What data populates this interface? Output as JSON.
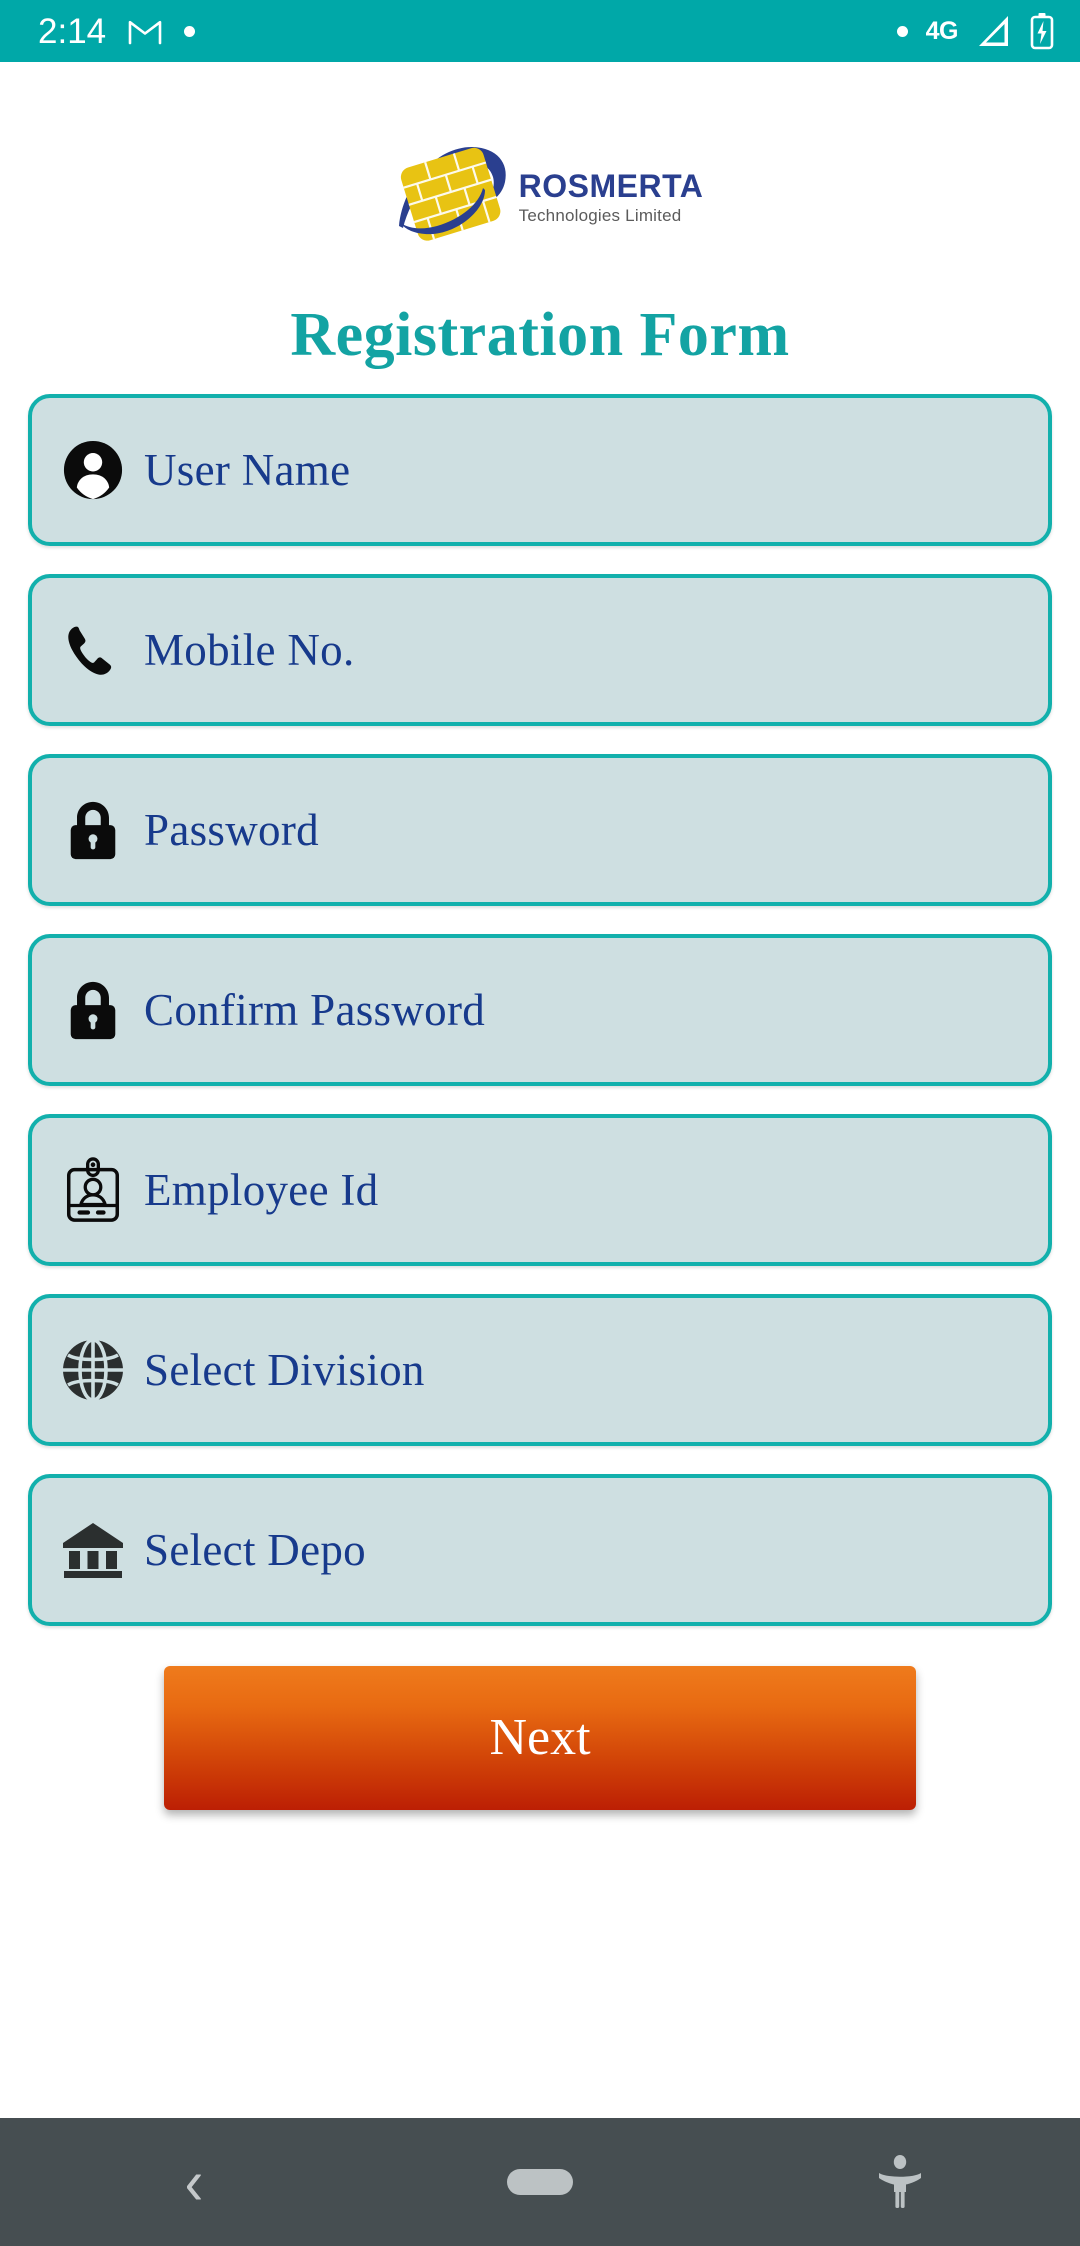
{
  "statusbar": {
    "time": "2:14",
    "left_icons": [
      {
        "name": "gmail-icon",
        "label": "M"
      },
      {
        "name": "notification-dot-icon",
        "label": ""
      }
    ],
    "right": {
      "dot": "",
      "network": "4G",
      "signal_icon": "signal-triangle-icon",
      "battery_icon": "battery-charging-icon"
    },
    "background_color": "#00a8a8",
    "foreground_color": "#ffffff"
  },
  "logo": {
    "name": "ROSMERTA",
    "subtitle": "Technologies Limited",
    "mark_icon": "rosmerta-brick-swoosh-logo",
    "name_color": "#2a3f8f",
    "subtitle_color": "#5b5b5b",
    "brick_color": "#e8c313",
    "swoosh_color": "#2a3f8f"
  },
  "form": {
    "title": "Registration Form",
    "title_color": "#13a3a3",
    "field_bg_color": "#cedfe1",
    "field_border_color": "#12b0ac",
    "field_text_color": "#173a8c",
    "fields": [
      {
        "icon": "person-icon",
        "placeholder": "User Name",
        "value": "",
        "type": "text"
      },
      {
        "icon": "phone-icon",
        "placeholder": "Mobile No.",
        "value": "",
        "type": "tel"
      },
      {
        "icon": "lock-icon",
        "placeholder": "Password",
        "value": "",
        "type": "password"
      },
      {
        "icon": "lock-icon",
        "placeholder": "Confirm Password",
        "value": "",
        "type": "password"
      },
      {
        "icon": "id-badge-icon",
        "placeholder": "Employee Id",
        "value": "",
        "type": "text"
      },
      {
        "icon": "globe-icon",
        "placeholder": "Select Division",
        "value": "",
        "type": "select"
      },
      {
        "icon": "bank-icon",
        "placeholder": "Select Depo",
        "value": "",
        "type": "select"
      }
    ],
    "submit": {
      "label": "Next",
      "gradient_from": "#ef7b1c",
      "gradient_to": "#bc1f04",
      "text_color": "#ffffff"
    }
  },
  "navbar": {
    "background_color": "#464e51",
    "back_glyph": "‹",
    "items": [
      {
        "name": "nav-back-button",
        "label": "Back"
      },
      {
        "name": "nav-home-button",
        "label": "Home"
      },
      {
        "name": "nav-accessibility-button",
        "label": "Accessibility"
      }
    ]
  }
}
